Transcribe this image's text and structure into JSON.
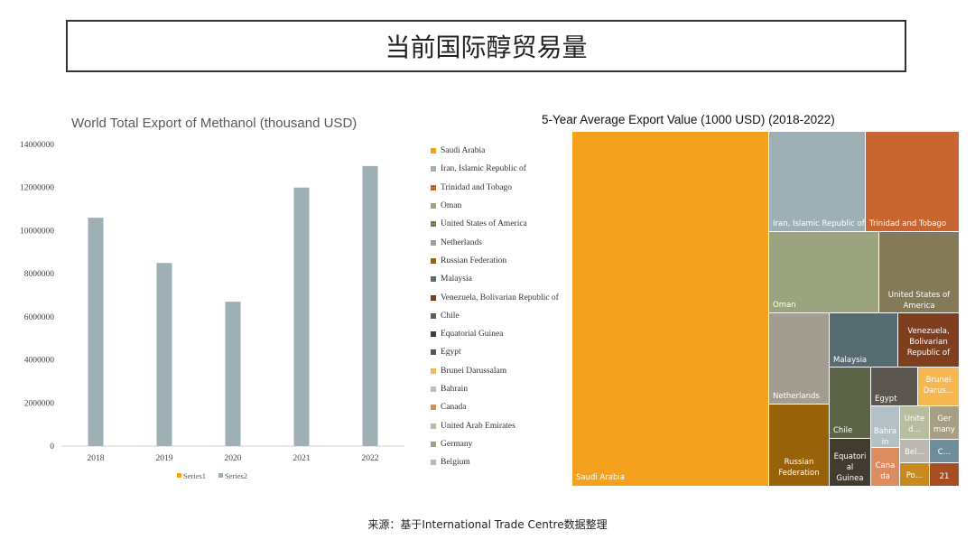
{
  "page_title": "当前国际醇贸易量",
  "source_text": "来源：基于International Trade Centre数据整理",
  "chart_data": [
    {
      "type": "bar",
      "title": "World Total Export of Methanol (thousand USD)",
      "categories": [
        "2018",
        "2019",
        "2020",
        "2021",
        "2022"
      ],
      "series": [
        {
          "name": "Series1",
          "color": "#F4A11E",
          "values": [
            0,
            0,
            0,
            0,
            0
          ]
        },
        {
          "name": "Series2",
          "color": "#9EAFB5",
          "values": [
            10600000,
            8500000,
            6700000,
            12000000,
            13000000
          ]
        }
      ],
      "ylim": [
        0,
        14000000
      ],
      "yticks": [
        "0",
        "2000000",
        "4000000",
        "6000000",
        "8000000",
        "10000000",
        "12000000",
        "14000000"
      ],
      "yticks_values": [
        0,
        2000000,
        4000000,
        6000000,
        8000000,
        10000000,
        12000000,
        14000000
      ],
      "grid": false,
      "legend_position": "bottom"
    },
    {
      "type": "treemap",
      "title": "5-Year Average Export Value (1000 USD) (2018-2022)",
      "legend_position": "left",
      "legend": [
        {
          "name": "Saudi Arabia",
          "color": "#F4A11E"
        },
        {
          "name": "Iran, Islamic Republic of",
          "color": "#9EAFB5"
        },
        {
          "name": "Trinidad and Tobago",
          "color": "#C96530"
        },
        {
          "name": "Oman",
          "color": "#9BA47E"
        },
        {
          "name": "United States of America",
          "color": "#857A58"
        },
        {
          "name": "Netherlands",
          "color": "#A39C91"
        },
        {
          "name": "Russian Federation",
          "color": "#98620A"
        },
        {
          "name": "Malaysia",
          "color": "#556B70"
        },
        {
          "name": "Venezuela, Bolivarian Republic of",
          "color": "#7F3F1F"
        },
        {
          "name": "Chile",
          "color": "#5C6447"
        },
        {
          "name": "Equatorial Guinea",
          "color": "#423C30"
        },
        {
          "name": "Egypt",
          "color": "#5B5650"
        },
        {
          "name": "Brunei Darussalam",
          "color": "#F6B650"
        },
        {
          "name": "Bahrain",
          "color": "#B3C1C6"
        },
        {
          "name": "Canada",
          "color": "#DC8D60"
        },
        {
          "name": "United Arab Emirates",
          "color": "#B6BE9F"
        },
        {
          "name": "Germany",
          "color": "#A79E86"
        },
        {
          "name": "Belgium",
          "color": "#BCB8B0"
        }
      ],
      "tiles": [
        {
          "label": "Saudi Arabia",
          "color": "#F4A11E"
        },
        {
          "label": "Iran, Islamic Republic of",
          "color": "#9EAFB5"
        },
        {
          "label": "Trinidad and Tobago",
          "color": "#C96530"
        },
        {
          "label": "Oman",
          "color": "#9BA47E"
        },
        {
          "label": "United States of America",
          "color": "#857A58"
        },
        {
          "label": "Netherlands",
          "color": "#A39C91"
        },
        {
          "label": "Malaysia",
          "color": "#556B70"
        },
        {
          "label": "Venezuela, Bolivarian Republic of",
          "color": "#7F3F1F"
        },
        {
          "label": "Russian Federation",
          "color": "#98620A"
        },
        {
          "label": "Chile",
          "color": "#5C6447"
        },
        {
          "label": "Egypt",
          "color": "#5B5650"
        },
        {
          "label": "Brunei Darussalam",
          "color": "#F6B650"
        },
        {
          "label": "Equatorial Guinea",
          "color": "#423C30"
        },
        {
          "label": "Bahrain",
          "color": "#B3C1C6"
        },
        {
          "label": "United Arab Emirates",
          "color": "#B6BE9F"
        },
        {
          "label": "Germany",
          "color": "#A79E86"
        },
        {
          "label": "Canada",
          "color": "#DC8D60"
        },
        {
          "label": "Belgium",
          "color": "#BCB8B0"
        },
        {
          "label": "C…",
          "color": "#6E8C99"
        },
        {
          "label": "Po…",
          "color": "#C88A1E"
        },
        {
          "label": "21",
          "color": "#A64E22"
        }
      ]
    }
  ]
}
